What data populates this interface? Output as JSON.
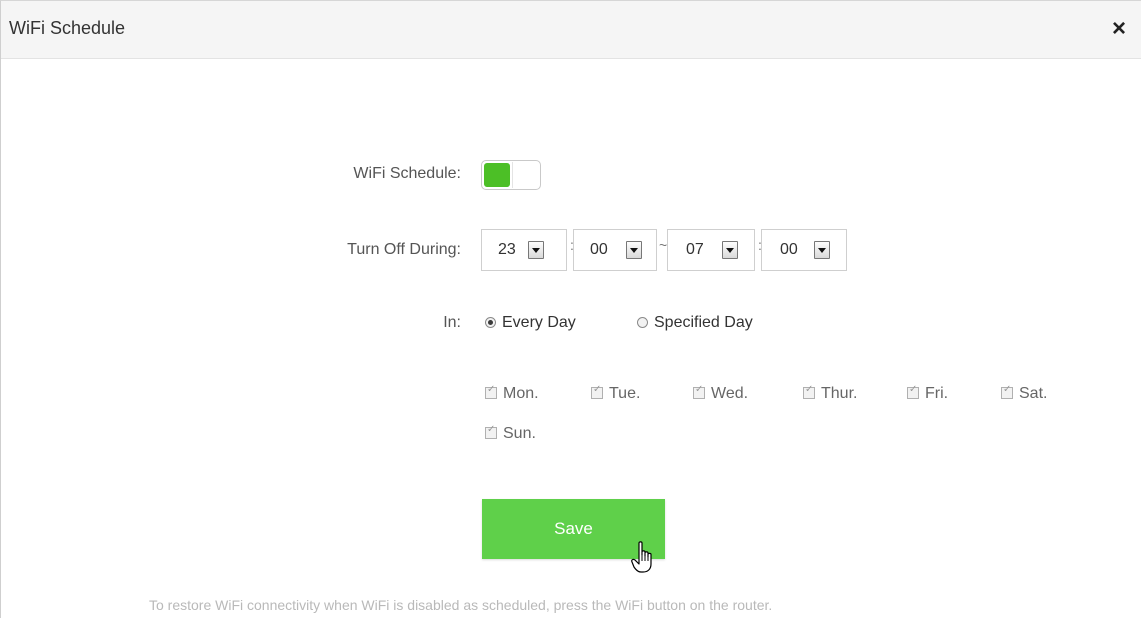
{
  "dialog": {
    "title": "WiFi Schedule",
    "close_icon": "×"
  },
  "form": {
    "schedule_label": "WiFi Schedule:",
    "schedule_enabled": true,
    "turn_off_label": "Turn Off During:",
    "start_hour": "23",
    "start_minute": "00",
    "range_sep": "~",
    "time_sep": ":",
    "end_hour": "07",
    "end_minute": "00",
    "in_label": "In:",
    "every_day": "Every Day",
    "specified_day": "Specified Day",
    "days": [
      "Mon.",
      "Tue.",
      "Wed.",
      "Thur.",
      "Fri.",
      "Sat.",
      "Sun."
    ],
    "save_label": "Save"
  },
  "note": "To restore WiFi connectivity when WiFi is disabled as scheduled, press the WiFi button on the router.",
  "colors": {
    "accent": "#5fd04a",
    "toggle_on": "#4cbf26"
  }
}
